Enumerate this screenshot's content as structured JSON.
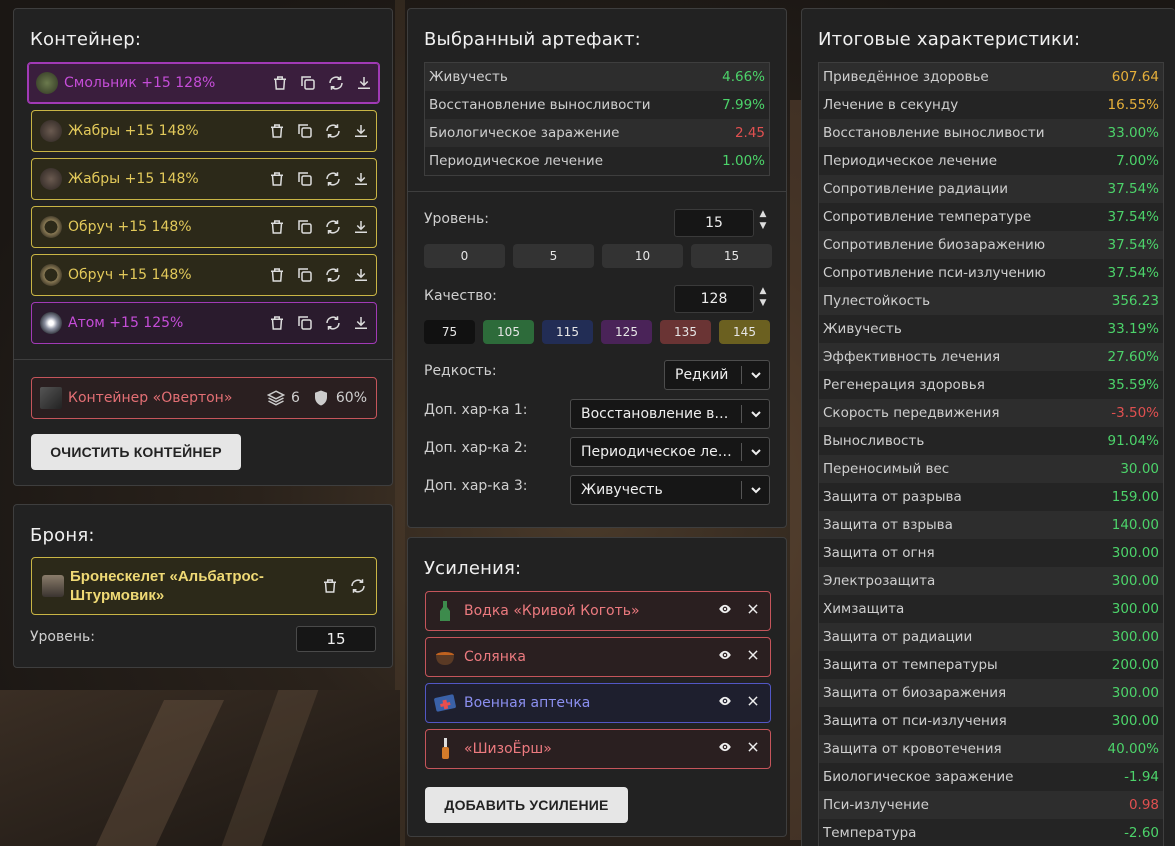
{
  "container": {
    "title": "Контейнер:",
    "artifacts": [
      {
        "name": "Смольник +15 128%",
        "rarity": "epic",
        "selected": true,
        "icon": "smolnik-icon"
      },
      {
        "name": "Жабры +15 148%",
        "rarity": "rare",
        "selected": false,
        "icon": "gills-icon"
      },
      {
        "name": "Жабры +15 148%",
        "rarity": "rare",
        "selected": false,
        "icon": "gills-icon"
      },
      {
        "name": "Обруч +15 148%",
        "rarity": "rare",
        "selected": false,
        "icon": "hoop-icon"
      },
      {
        "name": "Обруч +15 148%",
        "rarity": "rare",
        "selected": false,
        "icon": "hoop-icon"
      },
      {
        "name": "Атом +15 125%",
        "rarity": "epic",
        "selected": false,
        "icon": "atom-icon"
      }
    ],
    "container_item": {
      "name": "Контейнер «Овертон»",
      "slots": "6",
      "protection": "60%"
    },
    "clear_button": "ОЧИСТИТЬ КОНТЕЙНЕР"
  },
  "armor": {
    "title": "Броня:",
    "name": "Бронескелет «Альбатрос-Штурмовик»",
    "level_label": "Уровень:",
    "level": "15"
  },
  "artifact": {
    "title": "Выбранный артефакт:",
    "stats": [
      {
        "label": "Живучесть",
        "value": "4.66%",
        "tone": "pos"
      },
      {
        "label": "Восстановление выносливости",
        "value": "7.99%",
        "tone": "pos"
      },
      {
        "label": "Биологическое заражение",
        "value": "2.45",
        "tone": "neg"
      },
      {
        "label": "Периодическое лечение",
        "value": "1.00%",
        "tone": "pos"
      }
    ],
    "level_label": "Уровень:",
    "level": "15",
    "level_presets": [
      "0",
      "5",
      "10",
      "15"
    ],
    "quality_label": "Качество:",
    "quality": "128",
    "quality_presets": [
      {
        "label": "75",
        "color": "#111111"
      },
      {
        "label": "105",
        "color": "#2d6b3a"
      },
      {
        "label": "115",
        "color": "#222d55"
      },
      {
        "label": "125",
        "color": "#4a2358"
      },
      {
        "label": "135",
        "color": "#6a3434"
      },
      {
        "label": "145",
        "color": "#6b6020"
      }
    ],
    "rarity_label": "Редкость:",
    "rarity": "Редкий",
    "extra1_label": "Доп. хар-ка 1:",
    "extra1": "Восстановление выносливости",
    "extra2_label": "Доп. хар-ка 2:",
    "extra2": "Периодическое лечение",
    "extra3_label": "Доп. хар-ка 3:",
    "extra3": "Живучесть"
  },
  "buffs": {
    "title": "Усиления:",
    "items": [
      {
        "name": "Водка «Кривой Коготь»",
        "tone": "red",
        "icon": "bottle-icon"
      },
      {
        "name": "Солянка",
        "tone": "red",
        "icon": "soup-icon"
      },
      {
        "name": "Военная аптечка",
        "tone": "blue",
        "icon": "medkit-icon"
      },
      {
        "name": "«ШизоЁрш»",
        "tone": "red",
        "icon": "brush-icon"
      }
    ],
    "add_button": "ДОБАВИТЬ УСИЛЕНИЕ"
  },
  "totals": {
    "title": "Итоговые характеристики:",
    "rows": [
      {
        "label": "Приведённое здоровье",
        "value": "607.64",
        "tone": "gold"
      },
      {
        "label": "Лечение в секунду",
        "value": "16.55%",
        "tone": "gold"
      },
      {
        "label": "Восстановление выносливости",
        "value": "33.00%",
        "tone": "pos"
      },
      {
        "label": "Периодическое лечение",
        "value": "7.00%",
        "tone": "pos"
      },
      {
        "label": "Сопротивление радиации",
        "value": "37.54%",
        "tone": "pos"
      },
      {
        "label": "Сопротивление температуре",
        "value": "37.54%",
        "tone": "pos"
      },
      {
        "label": "Сопротивление биозаражению",
        "value": "37.54%",
        "tone": "pos"
      },
      {
        "label": "Сопротивление пси-излучению",
        "value": "37.54%",
        "tone": "pos"
      },
      {
        "label": "Пулестойкость",
        "value": "356.23",
        "tone": "pos"
      },
      {
        "label": "Живучесть",
        "value": "33.19%",
        "tone": "pos"
      },
      {
        "label": "Эффективность лечения",
        "value": "27.60%",
        "tone": "pos"
      },
      {
        "label": "Регенерация здоровья",
        "value": "35.59%",
        "tone": "pos"
      },
      {
        "label": "Скорость передвижения",
        "value": "-3.50%",
        "tone": "neg"
      },
      {
        "label": "Выносливость",
        "value": "91.04%",
        "tone": "pos"
      },
      {
        "label": "Переносимый вес",
        "value": "30.00",
        "tone": "pos"
      },
      {
        "label": "Защита от разрыва",
        "value": "159.00",
        "tone": "pos"
      },
      {
        "label": "Защита от взрыва",
        "value": "140.00",
        "tone": "pos"
      },
      {
        "label": "Защита от огня",
        "value": "300.00",
        "tone": "pos"
      },
      {
        "label": "Электрозащита",
        "value": "300.00",
        "tone": "pos"
      },
      {
        "label": "Химзащита",
        "value": "300.00",
        "tone": "pos"
      },
      {
        "label": "Защита от радиации",
        "value": "300.00",
        "tone": "pos"
      },
      {
        "label": "Защита от температуры",
        "value": "200.00",
        "tone": "pos"
      },
      {
        "label": "Защита от биозаражения",
        "value": "300.00",
        "tone": "pos"
      },
      {
        "label": "Защита от пси-излучения",
        "value": "300.00",
        "tone": "pos"
      },
      {
        "label": "Защита от кровотечения",
        "value": "40.00%",
        "tone": "pos"
      },
      {
        "label": "Биологическое заражение",
        "value": "-1.94",
        "tone": "pos"
      },
      {
        "label": "Пси-излучение",
        "value": "0.98",
        "tone": "neg"
      },
      {
        "label": "Температура",
        "value": "-2.60",
        "tone": "pos"
      }
    ]
  }
}
